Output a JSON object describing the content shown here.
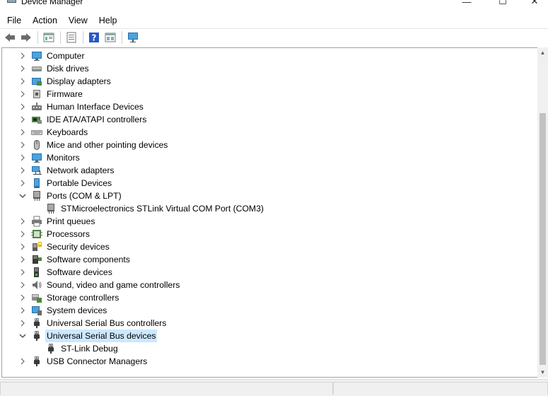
{
  "window": {
    "title": "Device Manager",
    "minimize": "—",
    "maximize": "☐",
    "close": "✕"
  },
  "menu": [
    "File",
    "Action",
    "View",
    "Help"
  ],
  "toolbar": [
    {
      "name": "back-icon"
    },
    {
      "name": "forward-icon"
    },
    {
      "sep": true
    },
    {
      "name": "properties-icon"
    },
    {
      "sep": true
    },
    {
      "name": "update-driver-icon"
    },
    {
      "sep": true
    },
    {
      "name": "help-icon"
    },
    {
      "name": "view-icon"
    },
    {
      "sep": true
    },
    {
      "name": "monitor-scan-icon"
    }
  ],
  "tree": [
    {
      "label": "Computer",
      "icon": "computer-icon",
      "level": 0,
      "expanded": false
    },
    {
      "label": "Disk drives",
      "icon": "disk-drive-icon",
      "level": 0,
      "expanded": false
    },
    {
      "label": "Display adapters",
      "icon": "display-adapter-icon",
      "level": 0,
      "expanded": false
    },
    {
      "label": "Firmware",
      "icon": "firmware-icon",
      "level": 0,
      "expanded": false
    },
    {
      "label": "Human Interface Devices",
      "icon": "hid-icon",
      "level": 0,
      "expanded": false
    },
    {
      "label": "IDE ATA/ATAPI controllers",
      "icon": "ide-controller-icon",
      "level": 0,
      "expanded": false
    },
    {
      "label": "Keyboards",
      "icon": "keyboard-icon",
      "level": 0,
      "expanded": false
    },
    {
      "label": "Mice and other pointing devices",
      "icon": "mouse-icon",
      "level": 0,
      "expanded": false
    },
    {
      "label": "Monitors",
      "icon": "monitor-icon",
      "level": 0,
      "expanded": false
    },
    {
      "label": "Network adapters",
      "icon": "network-adapter-icon",
      "level": 0,
      "expanded": false
    },
    {
      "label": "Portable Devices",
      "icon": "portable-device-icon",
      "level": 0,
      "expanded": false
    },
    {
      "label": "Ports (COM & LPT)",
      "icon": "port-icon",
      "level": 0,
      "expanded": true
    },
    {
      "label": "STMicroelectronics STLink Virtual COM Port (COM3)",
      "icon": "port-icon",
      "level": 1
    },
    {
      "label": "Print queues",
      "icon": "printer-icon",
      "level": 0,
      "expanded": false
    },
    {
      "label": "Processors",
      "icon": "processor-icon",
      "level": 0,
      "expanded": false
    },
    {
      "label": "Security devices",
      "icon": "security-device-icon",
      "level": 0,
      "expanded": false
    },
    {
      "label": "Software components",
      "icon": "software-component-icon",
      "level": 0,
      "expanded": false
    },
    {
      "label": "Software devices",
      "icon": "software-device-icon",
      "level": 0,
      "expanded": false
    },
    {
      "label": "Sound, video and game controllers",
      "icon": "speaker-icon",
      "level": 0,
      "expanded": false
    },
    {
      "label": "Storage controllers",
      "icon": "storage-controller-icon",
      "level": 0,
      "expanded": false
    },
    {
      "label": "System devices",
      "icon": "system-device-icon",
      "level": 0,
      "expanded": false
    },
    {
      "label": "Universal Serial Bus controllers",
      "icon": "usb-icon",
      "level": 0,
      "expanded": false
    },
    {
      "label": "Universal Serial Bus devices",
      "icon": "usb-icon",
      "level": 0,
      "expanded": true,
      "selected": true
    },
    {
      "label": "ST-Link Debug",
      "icon": "usb-icon",
      "level": 1
    },
    {
      "label": "USB Connector Managers",
      "icon": "usb-icon",
      "level": 0,
      "expanded": false
    }
  ],
  "colors": {
    "selection": "#cce8ff",
    "monitor": "#4aa3df",
    "chip": "#4a8a3a",
    "help": "#2b57c5"
  }
}
